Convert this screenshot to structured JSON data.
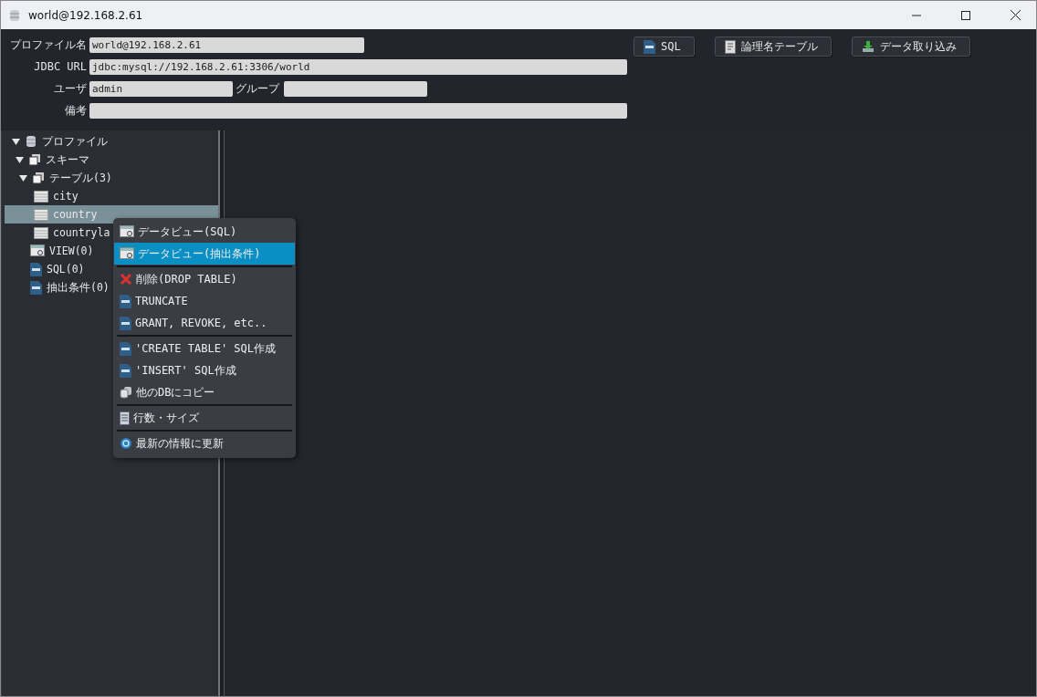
{
  "window": {
    "title": "world@192.168.2.61"
  },
  "form": {
    "rows": [
      {
        "label": "プロファイル名",
        "fields": [
          {
            "kind": "text",
            "value": "world@192.168.2.61"
          }
        ]
      },
      {
        "label": "JDBC URL",
        "fields": [
          {
            "kind": "text",
            "value": "jdbc:mysql://192.168.2.61:3306/world"
          }
        ]
      },
      {
        "label": "ユーザ",
        "fields": [
          {
            "kind": "text",
            "value": "admin"
          },
          {
            "kind": "text",
            "label": "グループ"
          }
        ]
      },
      {
        "label": "備考",
        "fields": [
          {
            "kind": "text"
          }
        ]
      }
    ]
  },
  "toolbar": [
    {
      "label": "SQL",
      "kind": "sql"
    },
    {
      "label": "論理名テーブル",
      "kind": "document"
    },
    {
      "label": "データ取り込み",
      "kind": "import"
    }
  ],
  "tree": [
    {
      "label": "プロファイル",
      "kind": "database",
      "expanded": true,
      "selected": false,
      "children": [
        {
          "label": "スキーマ",
          "kind": "schema",
          "expanded": true,
          "selected": false,
          "children": [
            {
              "label": "テーブル(3)",
              "kind": "schema",
              "expanded": true,
              "selected": false,
              "children": [
                {
                  "label": "city",
                  "kind": "table",
                  "selected": false
                },
                {
                  "label": "country",
                  "kind": "table",
                  "selected": true
                },
                {
                  "label": "countryla",
                  "kind": "table",
                  "selected": false
                }
              ]
            },
            {
              "label": "VIEW(0)",
              "kind": "view",
              "selected": false
            },
            {
              "label": "SQL(0)",
              "kind": "sql",
              "selected": false
            },
            {
              "label": "抽出条件(0)",
              "kind": "sql",
              "selected": false
            }
          ]
        }
      ]
    }
  ],
  "context_menu": {
    "groups": [
      [
        {
          "label": "データビュー(SQL)",
          "kind": "view",
          "selected": false
        },
        {
          "label": "データビュー(抽出条件)",
          "kind": "view",
          "selected": true
        }
      ],
      [
        {
          "label": "削除(DROP TABLE)",
          "kind": "delete",
          "selected": false
        },
        {
          "label": "TRUNCATE",
          "kind": "sql",
          "selected": false
        },
        {
          "label": "GRANT, REVOKE, etc..",
          "kind": "sql",
          "selected": false
        }
      ],
      [
        {
          "label": "'CREATE TABLE' SQL作成",
          "kind": "sql",
          "selected": false
        },
        {
          "label": "'INSERT' SQL作成",
          "kind": "sql",
          "selected": false
        },
        {
          "label": "他のDBにコピー",
          "kind": "copy",
          "selected": false
        }
      ],
      [
        {
          "label": "行数・サイズ",
          "kind": "rows",
          "selected": false
        }
      ],
      [
        {
          "label": "最新の情報に更新",
          "kind": "refresh",
          "selected": false
        }
      ]
    ]
  }
}
